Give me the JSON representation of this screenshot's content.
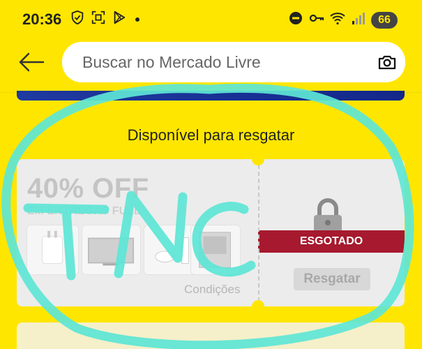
{
  "status_bar": {
    "time": "20:36",
    "battery": "66",
    "left_icons": [
      "shield-icon",
      "screenshot-icon",
      "play-store-icon",
      "dot-icon"
    ],
    "right_icons": [
      "do-not-disturb-icon",
      "key-icon",
      "wifi-icon",
      "signal-icon"
    ]
  },
  "header": {
    "search_placeholder": "Buscar no Mercado Livre"
  },
  "section": {
    "title": "Disponível para resgatar"
  },
  "coupon": {
    "discount": "40% OFF",
    "subtitle": "EM ENTREGAS FULL",
    "conditions": "Condições",
    "status": "ESGOTADO",
    "action": "Resgatar"
  },
  "annotation": {
    "text": "TNC",
    "color": "#5ee6d6"
  },
  "colors": {
    "background": "#ffe600",
    "sold_out": "#a6192e",
    "banner": "#1f3aa0"
  }
}
